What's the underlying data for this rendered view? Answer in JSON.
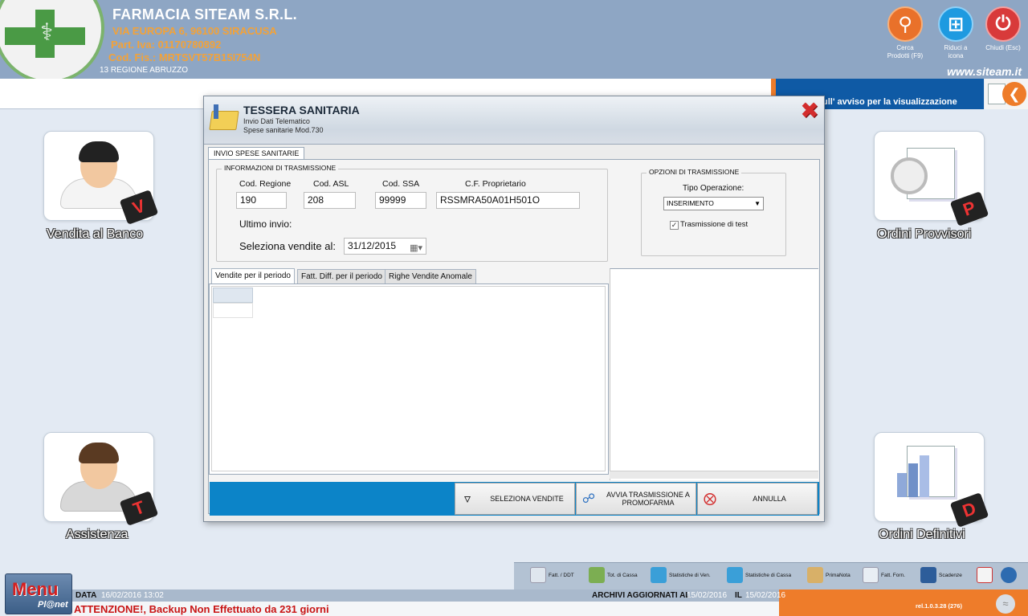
{
  "header": {
    "pharmacy_name": "FARMACIA SITEAM S.R.L.",
    "address": "VIA EUROPA 6, 96100 SIRACUSA",
    "vat": "Part. Iva: 01170780892",
    "fiscal_code": "Cod. Fis.: MRTSVT57B15I754N",
    "region": "13 REGIONE ABRUZZO",
    "site_url": "www.siteam.it",
    "buttons": {
      "search": "Cerca Prodotti (F9)",
      "minimize": "Riduci a icona",
      "close": "Chiudi (Esc)"
    }
  },
  "banner": {
    "text": "ull' avviso per la visualizzazione"
  },
  "tiles": {
    "sales": {
      "label": "Vendita al Banco",
      "badge": "V"
    },
    "provisional": {
      "label": "Ordini Provvisori",
      "badge": "P"
    },
    "support": {
      "label": "Assistenza",
      "badge": "T"
    },
    "definitive": {
      "label": "Ordini Definitivi",
      "badge": "D"
    }
  },
  "dialog": {
    "title": "TESSERA SANITARIA",
    "subtitle1": "Invio Dati Telematico",
    "subtitle2": "Spese sanitarie Mod.730",
    "main_tab": "INVIO SPESE SANITARIE",
    "transmission": {
      "legend": "INFORMAZIONI DI TRASMISSIONE",
      "cod_regione_label": "Cod. Regione",
      "cod_regione_value": "190",
      "cod_asl_label": "Cod. ASL",
      "cod_asl_value": "208",
      "cod_ssa_label": "Cod. SSA",
      "cod_ssa_value": "99999",
      "cf_label": "C.F. Proprietario",
      "cf_value": "RSSMRA50A01H501O",
      "last_send_label": "Ultimo invio:",
      "select_sales_label": "Seleziona vendite al:",
      "select_sales_date": "31/12/2015"
    },
    "options": {
      "legend": "OPZIONI DI TRASMISSIONE",
      "op_type_label": "Tipo Operazione:",
      "op_type_value": "INSERIMENTO",
      "test_label": "Trasmissione di test",
      "test_checked": true
    },
    "sub_tabs": [
      "Vendite per il periodo",
      "Fatt. Diff. per il periodo",
      "Righe Vendite Anomale"
    ],
    "actions": {
      "select_sales": "SELEZIONA VENDITE",
      "send": "AVVIA TRASMISSIONE A PROMOFARMA",
      "cancel": "ANNULLA"
    }
  },
  "taskbar": {
    "items": [
      "Fatt. / DDT",
      "Tot. di Cassa",
      "Statistiche di Ven.",
      "Statistiche di Cassa",
      "PrimaNota",
      "Fatt. Forn.",
      "Scadenze"
    ]
  },
  "status": {
    "menu_label": "Menu",
    "menu_sub": "Pl@net",
    "data_label": "DATA",
    "data_value": "16/02/2016  13:02",
    "archives_label": "ARCHIVI AGGIORNATI AL",
    "archives_date1": "15/02/2016",
    "archives_il": "IL",
    "archives_date2": "15/02/2016",
    "warning": "ATTENZIONE!, Backup Non Effettuato da 231 giorni",
    "release": "rel.1.0.3.28 (276)"
  },
  "colors": {
    "header_bg": "#8ea6c4",
    "orange_accent": "#ee7c2a",
    "blue_accent": "#0c84c8",
    "warning_red": "#c81414"
  }
}
